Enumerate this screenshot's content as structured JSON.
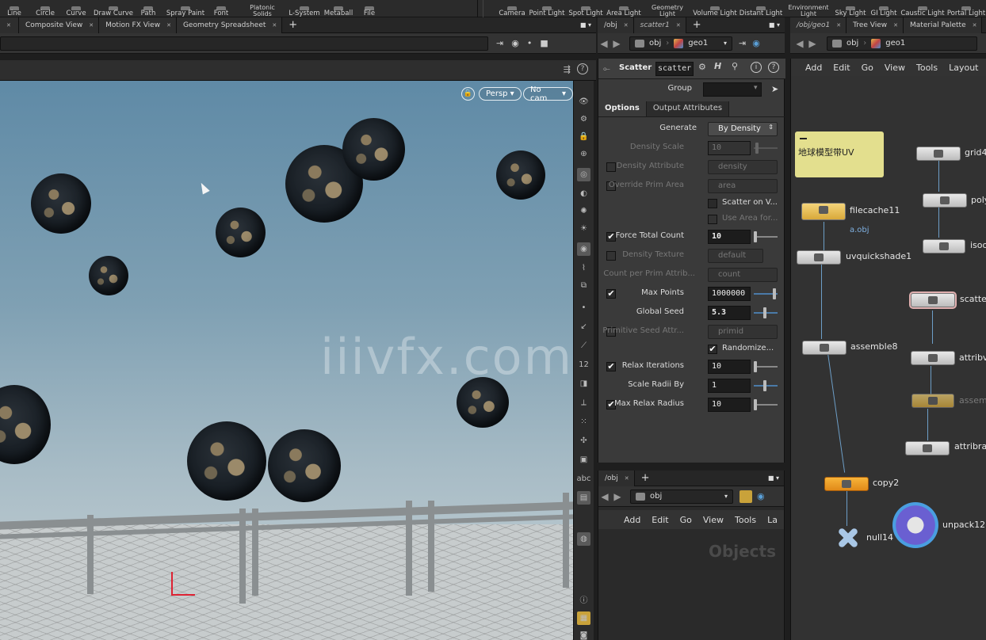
{
  "shelf": {
    "tools": [
      "Line",
      "Circle",
      "Curve",
      "Draw Curve",
      "Path",
      "Spray Paint",
      "Font",
      "Platonic\nSolids",
      "L-System",
      "Metaball",
      "File"
    ],
    "lights": [
      "Camera",
      "Point Light",
      "Spot Light",
      "Area Light",
      "Geometry\nLight",
      "Volume Light",
      "Distant Light",
      "Environment\nLight",
      "Sky Light",
      "GI Light",
      "Caustic Light",
      "Portal Light"
    ]
  },
  "left_tabs": [
    "Composite View",
    "Motion FX View",
    "Geometry Spreadsheet"
  ],
  "mid_tabs": [
    "/obj",
    "scatter1"
  ],
  "right_tabs": [
    "/obj/geo1",
    "Tree View",
    "Material Palette"
  ],
  "mid_path": {
    "obj": "obj",
    "geo": "geo1"
  },
  "right_path": {
    "obj": "obj",
    "geo": "geo1"
  },
  "viewport": {
    "persp_label": "Persp",
    "cam_label": "No cam",
    "watermark": "iiivfx.com"
  },
  "net_menu": [
    "Add",
    "Edit",
    "Go",
    "View",
    "Tools",
    "Layout"
  ],
  "params": {
    "node_type": "Scatter",
    "node_name": "scatter",
    "group_label": "Group",
    "tabs": [
      "Options",
      "Output Attributes"
    ],
    "generate_label": "Generate",
    "generate_value": "By Density",
    "density_scale_label": "Density Scale",
    "density_scale_value": "10",
    "density_attribute_label": "Density Attribute",
    "density_attribute_value": "density",
    "override_prim_area_label": "Override Prim Area",
    "override_prim_area_value": "area",
    "scatter_on_v_label": "Scatter on V...",
    "use_area_for_label": "Use Area for...",
    "force_total_count_label": "Force Total Count",
    "force_total_count_value": "10",
    "density_texture_label": "Density Texture",
    "density_texture_value": "default",
    "count_per_prim_label": "Count per Prim Attrib...",
    "count_per_prim_value": "count",
    "max_points_label": "Max Points",
    "max_points_value": "1000000",
    "global_seed_label": "Global Seed",
    "global_seed_value": "5.3",
    "prim_seed_label": "Primitive Seed Attr...",
    "prim_seed_value": "primid",
    "randomize_label": "Randomize...",
    "relax_iterations_label": "Relax Iterations",
    "relax_iterations_value": "10",
    "scale_radii_label": "Scale Radii By",
    "scale_radii_value": "1",
    "max_relax_radius_label": "Max Relax Radius",
    "max_relax_radius_value": "10"
  },
  "lower_net": {
    "tab": "/obj",
    "path": "obj",
    "menu": [
      "Add",
      "Edit",
      "Go",
      "View",
      "Tools",
      "La"
    ],
    "watermark": "Objects"
  },
  "network": {
    "sticky_note": "地球模型带UV",
    "nodes": [
      {
        "name": "grid4"
      },
      {
        "name": "poly"
      },
      {
        "name": "isoo"
      },
      {
        "name": "scatte"
      },
      {
        "name": "filecache11",
        "sub": "a.obj"
      },
      {
        "name": "uvquickshade1"
      },
      {
        "name": "assemble8"
      },
      {
        "name": "attribv"
      },
      {
        "name": "assem"
      },
      {
        "name": "attribra"
      },
      {
        "name": "copy2"
      },
      {
        "name": "null14"
      },
      {
        "name": "unpack12"
      }
    ]
  }
}
